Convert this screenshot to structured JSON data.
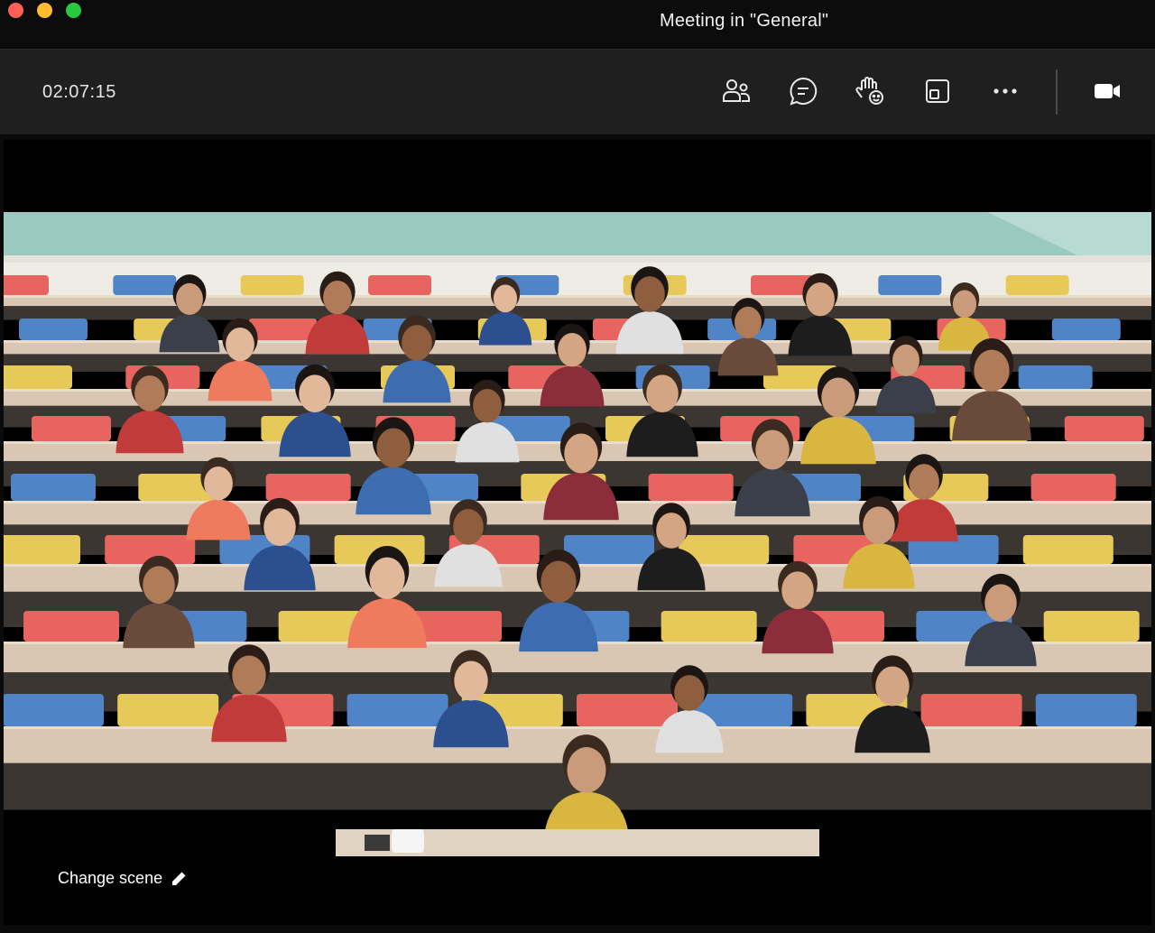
{
  "window": {
    "title": "Meeting in \"General\""
  },
  "toolbar": {
    "timer": "02:07:15",
    "buttons": [
      {
        "icon": "people-icon"
      },
      {
        "icon": "chat-icon"
      },
      {
        "icon": "react-icon"
      },
      {
        "icon": "view-icon"
      },
      {
        "icon": "more-icon"
      },
      {
        "icon": "camera-icon"
      }
    ]
  },
  "scene": {
    "change_scene_label": "Change scene",
    "change_scene_icon": "pencil-icon"
  },
  "colors": {
    "titlebar": "#0c0c0c",
    "toolbar": "#1f1f1f",
    "wall": "#9cc9bf",
    "desk": "#d9c7b3",
    "seat_red": "#e8655f",
    "seat_blue": "#4f84c6",
    "seat_yellow": "#e7c95a"
  }
}
